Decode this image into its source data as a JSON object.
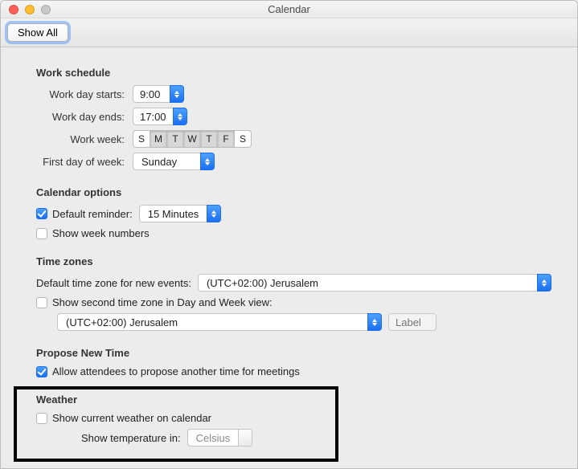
{
  "window": {
    "title": "Calendar"
  },
  "toolbar": {
    "show_all": "Show All"
  },
  "work_schedule": {
    "heading": "Work schedule",
    "starts_label": "Work day starts:",
    "starts_value": "9:00",
    "ends_label": "Work day ends:",
    "ends_value": "17:00",
    "week_label": "Work week:",
    "days": [
      {
        "letter": "S",
        "on": false
      },
      {
        "letter": "M",
        "on": true
      },
      {
        "letter": "T",
        "on": true
      },
      {
        "letter": "W",
        "on": true
      },
      {
        "letter": "T",
        "on": true
      },
      {
        "letter": "F",
        "on": true
      },
      {
        "letter": "S",
        "on": false
      }
    ],
    "first_day_label": "First day of week:",
    "first_day_value": "Sunday"
  },
  "calendar_options": {
    "heading": "Calendar options",
    "default_reminder_label": "Default reminder:",
    "default_reminder_checked": true,
    "default_reminder_value": "15 Minutes",
    "show_week_numbers_label": "Show week numbers",
    "show_week_numbers_checked": false
  },
  "time_zones": {
    "heading": "Time zones",
    "default_tz_label": "Default time zone for new events:",
    "default_tz_value": "(UTC+02:00) Jerusalem",
    "second_tz_label": "Show second time zone in Day and Week view:",
    "second_tz_checked": false,
    "second_tz_value": "(UTC+02:00) Jerusalem",
    "second_tz_label_placeholder": "Label"
  },
  "propose": {
    "heading": "Propose New Time",
    "allow_label": "Allow attendees to propose another time for meetings",
    "allow_checked": true
  },
  "weather": {
    "heading": "Weather",
    "show_label": "Show current weather on calendar",
    "show_checked": false,
    "temp_label": "Show temperature in:",
    "temp_value": "Celsius"
  }
}
